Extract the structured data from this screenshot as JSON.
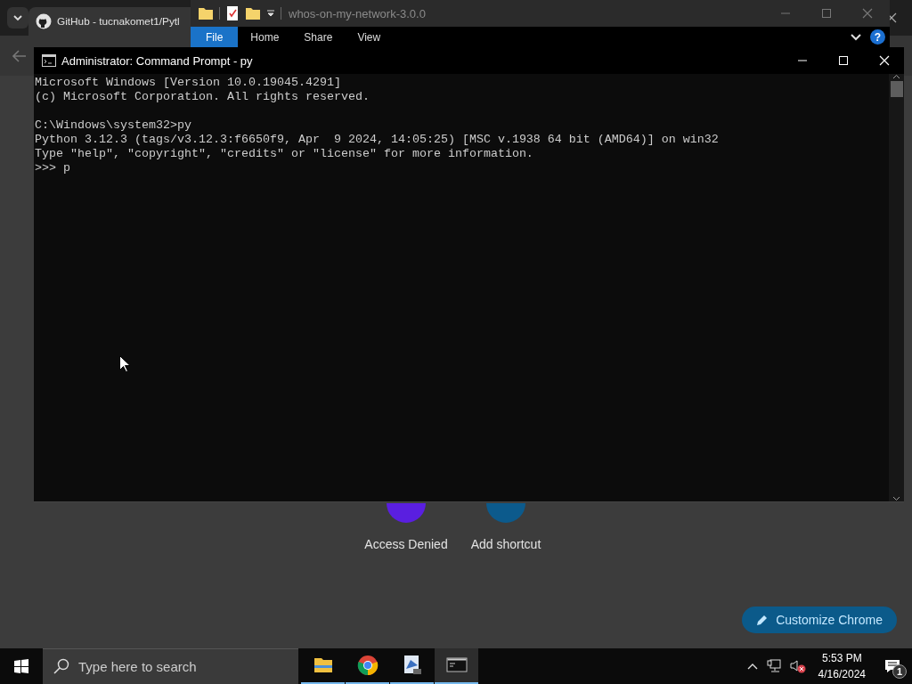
{
  "browser": {
    "tab_title": "GitHub - tucnakomet1/Pytl",
    "shortcuts": [
      {
        "label": "Access Denied",
        "color": "#5a1fe0"
      },
      {
        "label": "Add shortcut",
        "color": "#0c5a8c"
      }
    ],
    "customize_button": "Customize Chrome"
  },
  "explorer": {
    "title": "whos-on-my-network-3.0.0",
    "ribbon_tabs": [
      {
        "label": "File",
        "selected": true
      },
      {
        "label": "Home",
        "selected": false
      },
      {
        "label": "Share",
        "selected": false
      },
      {
        "label": "View",
        "selected": false
      }
    ],
    "help_glyph": "?"
  },
  "terminal": {
    "title": "Administrator: Command Prompt - py",
    "paragraphs": [
      [
        "Microsoft Windows [Version 10.0.19045.4291]",
        "(c) Microsoft Corporation. All rights reserved."
      ],
      [
        "C:\\Windows\\system32>py",
        "Python 3.12.3 (tags/v3.12.3:f6650f9, Apr  9 2024, 14:05:25) [MSC v.1938 64 bit (AMD64)] on win32",
        "Type \"help\", \"copyright\", \"credits\" or \"license\" for more information.",
        ">>> p"
      ]
    ]
  },
  "taskbar": {
    "search_placeholder": "Type here to search",
    "apps": [
      {
        "kind": "folder",
        "selected": false
      },
      {
        "kind": "browser",
        "selected": false
      },
      {
        "kind": "remote",
        "selected": false
      },
      {
        "kind": "console",
        "selected": true
      }
    ],
    "clock": {
      "time": "5:53 PM",
      "date": "4/16/2024"
    },
    "notification_count": "1"
  }
}
